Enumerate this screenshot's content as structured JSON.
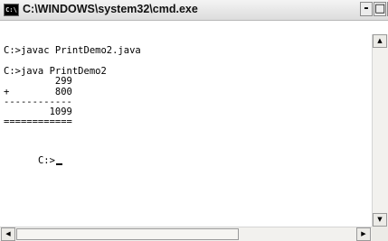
{
  "window": {
    "title": "C:\\WINDOWS\\system32\\cmd.exe",
    "icon_label": "C:\\",
    "controls": {
      "minimize": "-",
      "maximize": "□",
      "close": "×"
    }
  },
  "console": {
    "lines": [
      "C:>javac PrintDemo2.java",
      "C:>java PrintDemo2",
      "         299",
      "+        800",
      "------------",
      "        1099",
      "============",
      "C:>"
    ]
  },
  "scrollbars": {
    "up_arrow": "▲",
    "down_arrow": "▼",
    "left_arrow": "◀",
    "right_arrow": "▶"
  },
  "icons": [
    "console-app-icon",
    "scroll-up-icon",
    "scroll-down-icon",
    "scroll-left-icon",
    "scroll-right-icon"
  ]
}
